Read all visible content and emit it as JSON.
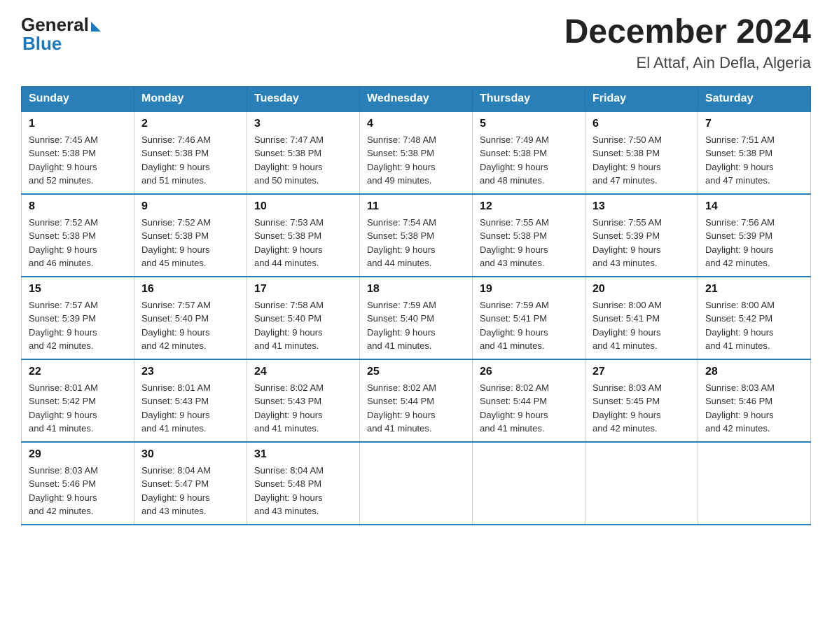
{
  "header": {
    "logo_general": "General",
    "logo_blue": "Blue",
    "month_title": "December 2024",
    "location": "El Attaf, Ain Defla, Algeria"
  },
  "days_of_week": [
    "Sunday",
    "Monday",
    "Tuesday",
    "Wednesday",
    "Thursday",
    "Friday",
    "Saturday"
  ],
  "weeks": [
    [
      {
        "day": "1",
        "sunrise": "7:45 AM",
        "sunset": "5:38 PM",
        "daylight": "9 hours and 52 minutes."
      },
      {
        "day": "2",
        "sunrise": "7:46 AM",
        "sunset": "5:38 PM",
        "daylight": "9 hours and 51 minutes."
      },
      {
        "day": "3",
        "sunrise": "7:47 AM",
        "sunset": "5:38 PM",
        "daylight": "9 hours and 50 minutes."
      },
      {
        "day": "4",
        "sunrise": "7:48 AM",
        "sunset": "5:38 PM",
        "daylight": "9 hours and 49 minutes."
      },
      {
        "day": "5",
        "sunrise": "7:49 AM",
        "sunset": "5:38 PM",
        "daylight": "9 hours and 48 minutes."
      },
      {
        "day": "6",
        "sunrise": "7:50 AM",
        "sunset": "5:38 PM",
        "daylight": "9 hours and 47 minutes."
      },
      {
        "day": "7",
        "sunrise": "7:51 AM",
        "sunset": "5:38 PM",
        "daylight": "9 hours and 47 minutes."
      }
    ],
    [
      {
        "day": "8",
        "sunrise": "7:52 AM",
        "sunset": "5:38 PM",
        "daylight": "9 hours and 46 minutes."
      },
      {
        "day": "9",
        "sunrise": "7:52 AM",
        "sunset": "5:38 PM",
        "daylight": "9 hours and 45 minutes."
      },
      {
        "day": "10",
        "sunrise": "7:53 AM",
        "sunset": "5:38 PM",
        "daylight": "9 hours and 44 minutes."
      },
      {
        "day": "11",
        "sunrise": "7:54 AM",
        "sunset": "5:38 PM",
        "daylight": "9 hours and 44 minutes."
      },
      {
        "day": "12",
        "sunrise": "7:55 AM",
        "sunset": "5:38 PM",
        "daylight": "9 hours and 43 minutes."
      },
      {
        "day": "13",
        "sunrise": "7:55 AM",
        "sunset": "5:39 PM",
        "daylight": "9 hours and 43 minutes."
      },
      {
        "day": "14",
        "sunrise": "7:56 AM",
        "sunset": "5:39 PM",
        "daylight": "9 hours and 42 minutes."
      }
    ],
    [
      {
        "day": "15",
        "sunrise": "7:57 AM",
        "sunset": "5:39 PM",
        "daylight": "9 hours and 42 minutes."
      },
      {
        "day": "16",
        "sunrise": "7:57 AM",
        "sunset": "5:40 PM",
        "daylight": "9 hours and 42 minutes."
      },
      {
        "day": "17",
        "sunrise": "7:58 AM",
        "sunset": "5:40 PM",
        "daylight": "9 hours and 41 minutes."
      },
      {
        "day": "18",
        "sunrise": "7:59 AM",
        "sunset": "5:40 PM",
        "daylight": "9 hours and 41 minutes."
      },
      {
        "day": "19",
        "sunrise": "7:59 AM",
        "sunset": "5:41 PM",
        "daylight": "9 hours and 41 minutes."
      },
      {
        "day": "20",
        "sunrise": "8:00 AM",
        "sunset": "5:41 PM",
        "daylight": "9 hours and 41 minutes."
      },
      {
        "day": "21",
        "sunrise": "8:00 AM",
        "sunset": "5:42 PM",
        "daylight": "9 hours and 41 minutes."
      }
    ],
    [
      {
        "day": "22",
        "sunrise": "8:01 AM",
        "sunset": "5:42 PM",
        "daylight": "9 hours and 41 minutes."
      },
      {
        "day": "23",
        "sunrise": "8:01 AM",
        "sunset": "5:43 PM",
        "daylight": "9 hours and 41 minutes."
      },
      {
        "day": "24",
        "sunrise": "8:02 AM",
        "sunset": "5:43 PM",
        "daylight": "9 hours and 41 minutes."
      },
      {
        "day": "25",
        "sunrise": "8:02 AM",
        "sunset": "5:44 PM",
        "daylight": "9 hours and 41 minutes."
      },
      {
        "day": "26",
        "sunrise": "8:02 AM",
        "sunset": "5:44 PM",
        "daylight": "9 hours and 41 minutes."
      },
      {
        "day": "27",
        "sunrise": "8:03 AM",
        "sunset": "5:45 PM",
        "daylight": "9 hours and 42 minutes."
      },
      {
        "day": "28",
        "sunrise": "8:03 AM",
        "sunset": "5:46 PM",
        "daylight": "9 hours and 42 minutes."
      }
    ],
    [
      {
        "day": "29",
        "sunrise": "8:03 AM",
        "sunset": "5:46 PM",
        "daylight": "9 hours and 42 minutes."
      },
      {
        "day": "30",
        "sunrise": "8:04 AM",
        "sunset": "5:47 PM",
        "daylight": "9 hours and 43 minutes."
      },
      {
        "day": "31",
        "sunrise": "8:04 AM",
        "sunset": "5:48 PM",
        "daylight": "9 hours and 43 minutes."
      },
      null,
      null,
      null,
      null
    ]
  ],
  "sunrise_label": "Sunrise:",
  "sunset_label": "Sunset:",
  "daylight_label": "Daylight:"
}
